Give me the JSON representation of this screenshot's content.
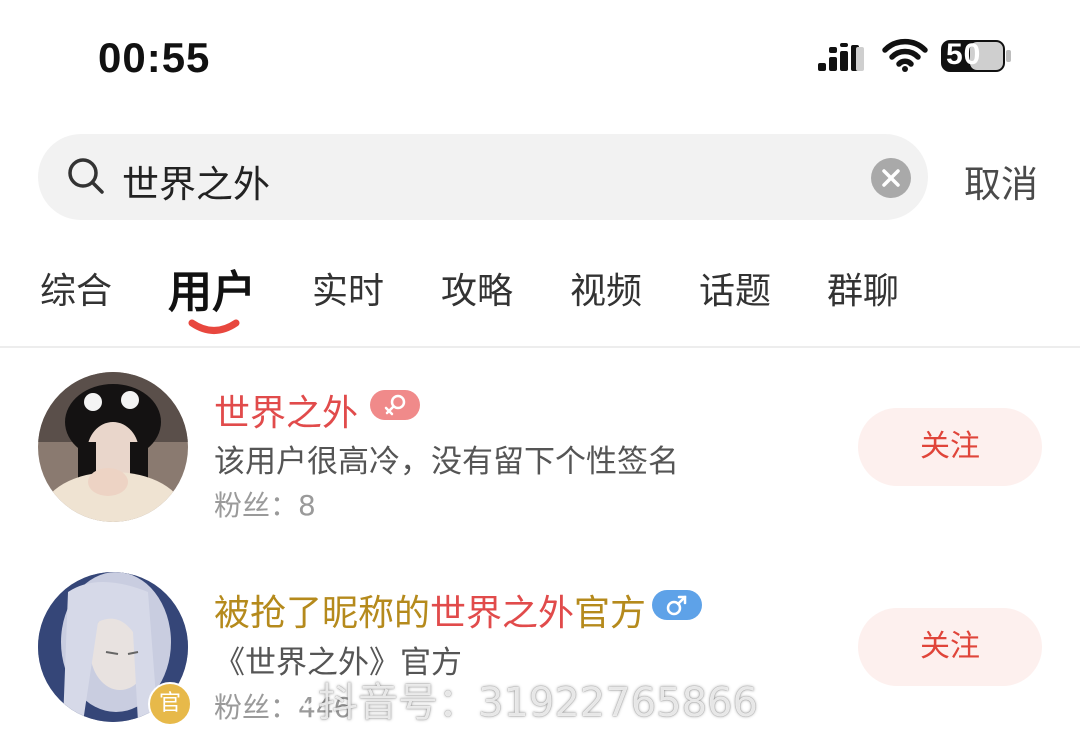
{
  "status_bar": {
    "time": "00:55",
    "battery": "50"
  },
  "search": {
    "query": "世界之外",
    "cancel_label": "取消"
  },
  "tabs": [
    {
      "label": "综合"
    },
    {
      "label": "用户",
      "active": true
    },
    {
      "label": "实时"
    },
    {
      "label": "攻略"
    },
    {
      "label": "视频"
    },
    {
      "label": "话题"
    },
    {
      "label": "群聊"
    }
  ],
  "results": [
    {
      "name_highlight": "世界之外",
      "gender": "female",
      "bio": "该用户很高冷，没有留下个性签名",
      "fans_label": "粉丝：",
      "fans_count": "8",
      "follow_label": "关注"
    },
    {
      "name_prefix": "被抢了昵称的",
      "name_highlight": "世界之外",
      "name_suffix": "官方",
      "gender": "male",
      "official_badge": "官",
      "bio": "《世界之外》官方",
      "fans_label": "粉丝：",
      "fans_count": "446",
      "follow_label": "关注"
    }
  ],
  "watermark": "抖音号：31922765866",
  "colors": {
    "accent": "#e14b4b",
    "follow_bg": "#fdf0ee",
    "gold": "#b58a1c",
    "female": "#f08a8a",
    "male": "#5ea2e8"
  }
}
